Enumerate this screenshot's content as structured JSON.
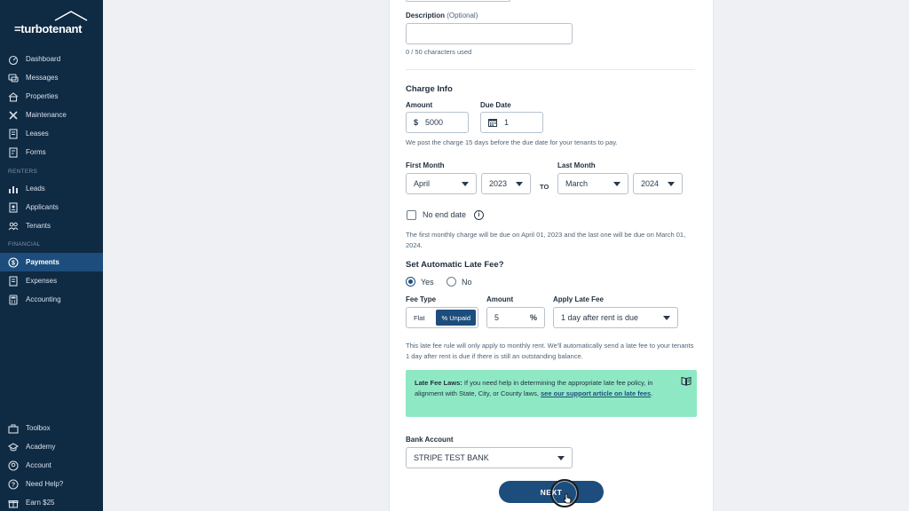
{
  "brand": {
    "name": "=turbotenant"
  },
  "sidebar": {
    "items_top": [
      {
        "label": "Dashboard",
        "icon": "gauge-icon"
      },
      {
        "label": "Messages",
        "icon": "chat-icon"
      },
      {
        "label": "Properties",
        "icon": "home-icon"
      },
      {
        "label": "Maintenance",
        "icon": "wrench-icon"
      },
      {
        "label": "Leases",
        "icon": "document-icon"
      },
      {
        "label": "Forms",
        "icon": "form-icon"
      }
    ],
    "section_renters": "RENTERS",
    "items_renters": [
      {
        "label": "Leads",
        "icon": "leads-icon"
      },
      {
        "label": "Applicants",
        "icon": "applicant-icon"
      },
      {
        "label": "Tenants",
        "icon": "tenants-icon"
      }
    ],
    "section_financial": "FINANCIAL",
    "items_financial": [
      {
        "label": "Payments",
        "icon": "dollar-icon",
        "active": true
      },
      {
        "label": "Expenses",
        "icon": "receipt-icon"
      },
      {
        "label": "Accounting",
        "icon": "calculator-icon"
      }
    ],
    "items_bottom": [
      {
        "label": "Toolbox",
        "icon": "toolbox-icon"
      },
      {
        "label": "Academy",
        "icon": "graduation-icon"
      },
      {
        "label": "Account",
        "icon": "account-icon"
      },
      {
        "label": "Need Help?",
        "icon": "help-icon"
      },
      {
        "label": "Earn $25",
        "icon": "gift-icon"
      }
    ]
  },
  "form": {
    "description_label": "Description",
    "description_optional": "(Optional)",
    "description_value": "",
    "char_count": "0 / 50 characters used",
    "charge_info_title": "Charge Info",
    "amount_label": "Amount",
    "amount_prefix": "$",
    "amount_value": "5000",
    "due_date_label": "Due Date",
    "due_date_value": "1",
    "charge_note": "We post the charge 15 days before the due date for your tenants to pay.",
    "first_month_label": "First Month",
    "first_month_value": "April",
    "first_year_value": "2023",
    "to_label": "TO",
    "last_month_label": "Last Month",
    "last_month_value": "March",
    "last_year_value": "2024",
    "no_end_date_label": "No end date",
    "schedule_note": "The first monthly charge will be due on April 01, 2023 and the last one will be due on March 01, 2024.",
    "late_fee_title": "Set Automatic Late Fee?",
    "yes_label": "Yes",
    "no_label": "No",
    "fee_type_label": "Fee Type",
    "fee_flat": "Flat",
    "fee_unpaid": "% Unpaid",
    "fee_amount_label": "Amount",
    "fee_amount_value": "5",
    "fee_amount_suffix": "%",
    "apply_late_fee_label": "Apply Late Fee",
    "apply_late_fee_value": "1 day after rent is due",
    "late_fee_note": "This late fee rule will only apply to monthly rent. We'll automatically send a late fee to your tenants 1 day after rent is due if there is still an outstanding balance.",
    "notice_bold": "Late Fee Laws:",
    "notice_text": " If you need help in determining the appropriate late fee policy, in alignment with State, City, or County laws, ",
    "notice_link": "see our support article on late fees",
    "notice_end": ".",
    "bank_account_label": "Bank Account",
    "bank_account_value": "STRIPE TEST BANK",
    "next_label": "NEXT"
  },
  "colors": {
    "sidebar_bg": "#0f2a43",
    "active_bg": "#1d4d7c",
    "notice_bg": "#8fe8c4",
    "link": "#1d4d7c"
  }
}
